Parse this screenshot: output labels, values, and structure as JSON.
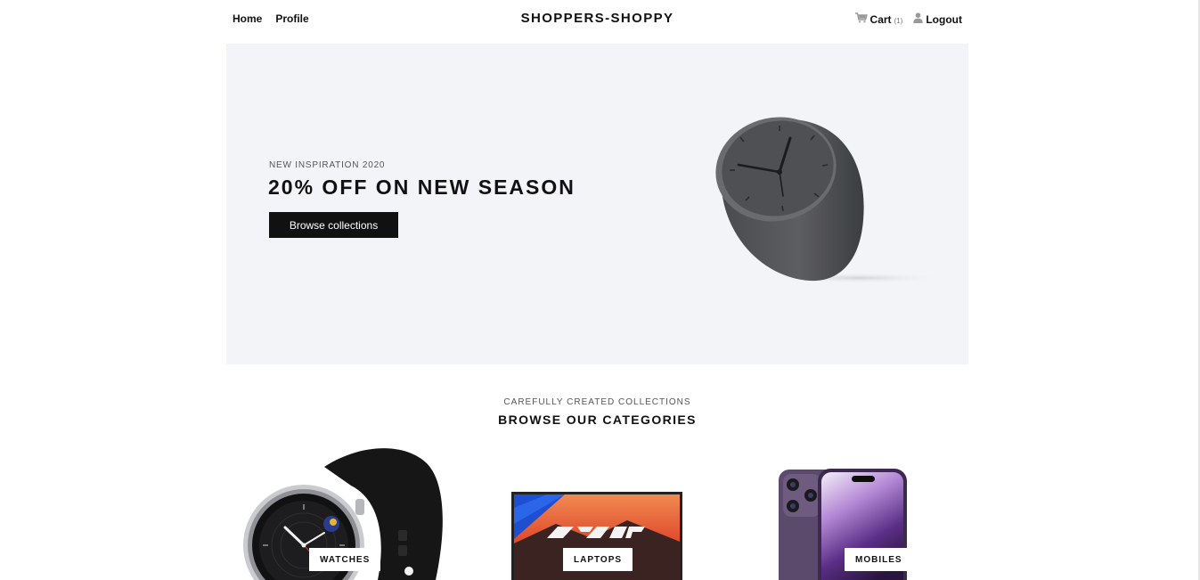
{
  "nav": {
    "home": "Home",
    "profile": "Profile",
    "brand": "SHOPPERS-SHOPPY",
    "cart": "Cart",
    "cart_count": "(1)",
    "logout": "Logout"
  },
  "hero": {
    "subtitle": "NEW INSPIRATION 2020",
    "title": "20% OFF ON NEW SEASON",
    "button": "Browse collections"
  },
  "categories_section": {
    "subtitle": "CAREFULLY CREATED COLLECTIONS",
    "title": "BROWSE OUR CATEGORIES",
    "items": [
      {
        "label": "WATCHES",
        "image": "smartwatch-image"
      },
      {
        "label": "LAPTOPS",
        "image": "laptop-image"
      },
      {
        "label": "MOBILES",
        "image": "smartphone-image"
      }
    ]
  },
  "icons": {
    "cart": "cart-icon",
    "user": "user-icon"
  },
  "colors": {
    "hero_bg": "#f3f4f7",
    "button_bg": "#111111",
    "text": "#111111"
  }
}
